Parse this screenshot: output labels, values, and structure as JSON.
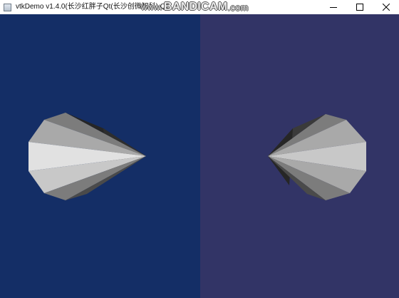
{
  "window": {
    "title": "vtkDemo v1.4.0(长沙红胖子Qt(长沙创微智科) QQ",
    "watermark": {
      "prefix": "www.",
      "brand": "BANDICAM",
      "suffix": ".com"
    },
    "controls": {
      "minimize_icon": "minimize-icon",
      "maximize_icon": "maximize-icon",
      "close_icon": "close-icon"
    }
  },
  "viewports": {
    "left": {
      "background": "#142e66",
      "object": "cone",
      "orientation": "apex-right"
    },
    "right": {
      "background": "#323466",
      "object": "cone",
      "orientation": "apex-left"
    }
  },
  "colors": {
    "face_light": "#e1e1e1",
    "face_mid_light": "#c8c8c8",
    "face_mid": "#a9a9a9",
    "face_dark": "#7c7c7c",
    "face_darker": "#4a4a4a",
    "face_darkest": "#262626"
  }
}
